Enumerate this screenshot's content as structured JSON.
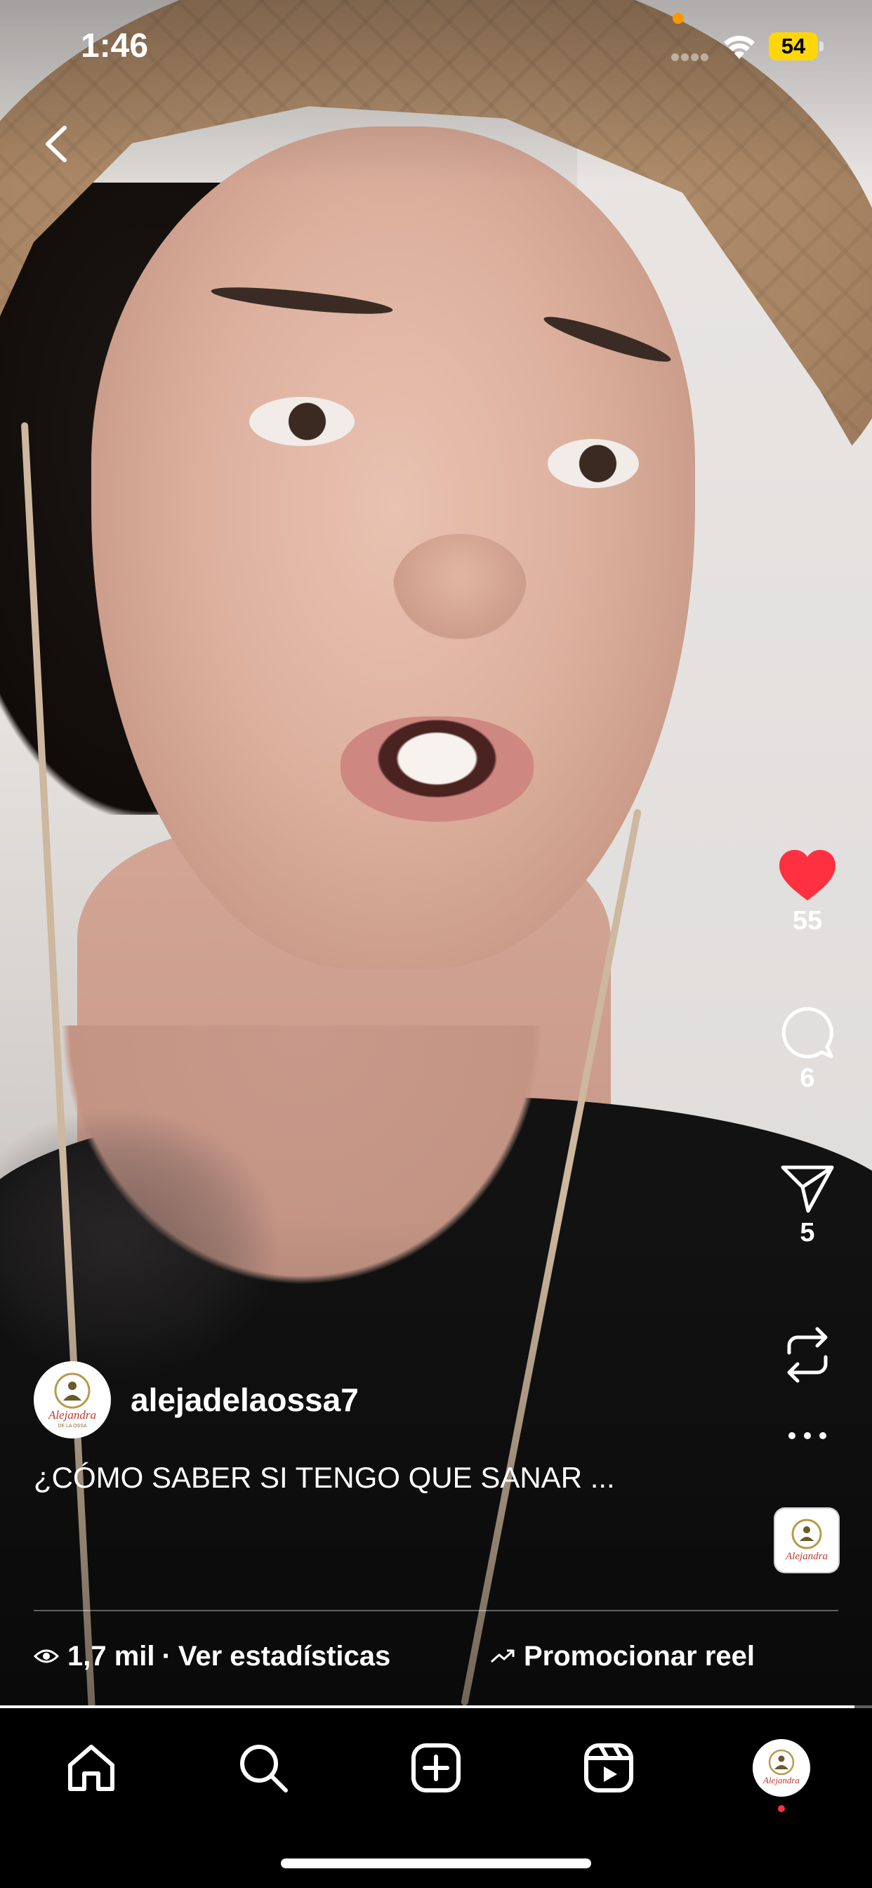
{
  "status_bar": {
    "time": "1:46",
    "battery": "54",
    "battery_color": "#ffd60a",
    "recording_dot_color": "#ff9500"
  },
  "reel": {
    "likes": "55",
    "comments": "6",
    "shares": "5",
    "liked": true,
    "like_color": "#ff3040",
    "author": {
      "username": "alejadelaossa7",
      "avatar_logo_text": "Alejandra",
      "avatar_logo_subtext": "DE LA OSSA"
    },
    "caption": "¿CÓMO SABER SI TENGO QUE SANAR ...",
    "views": "1,7 mil",
    "separator": "·",
    "insights_label": "Ver estadísticas",
    "promote_label": "Promocionar reel",
    "progress": 0.98
  },
  "icons": {
    "back": "chevron-left-icon",
    "like": "heart-icon",
    "comment": "comment-bubble-icon",
    "share": "paper-plane-icon",
    "remix": "repost-icon",
    "more": "more-horizontal-icon",
    "views": "eye-icon",
    "promote": "trend-up-icon"
  },
  "tab_bar": {
    "tabs": [
      "home",
      "search",
      "create",
      "reels",
      "profile"
    ],
    "active": "reels",
    "notification_dot_color": "#ff3040"
  }
}
